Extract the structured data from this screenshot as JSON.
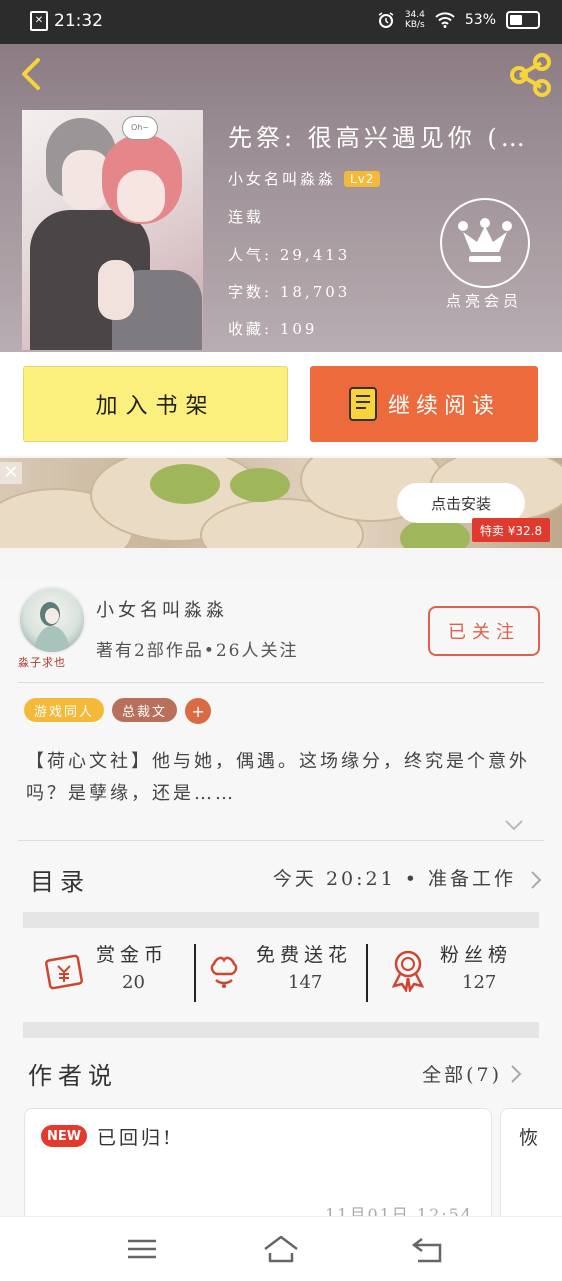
{
  "status_bar": {
    "time": "21:32",
    "net_speed_top": "34.4",
    "net_speed_unit": "KB/s",
    "battery": "53%",
    "battery_level": 0.53
  },
  "book": {
    "title": "先祭: 很高兴遇见你 (…",
    "author": "小女名叫淼淼",
    "author_level": "Lv2",
    "status": "连载",
    "popularity_label": "人气:",
    "popularity": "29,413",
    "words_label": "字数:",
    "words": "18,703",
    "favorites_label": "收藏:",
    "favorites": "109",
    "vip_label": "点亮会员",
    "cover_bubble": "Oh~"
  },
  "actions": {
    "add_shelf": "加入书架",
    "continue_read": "继续阅读"
  },
  "ad": {
    "install": "点击安装",
    "price": "特卖 ¥32.8"
  },
  "author_card": {
    "name": "小女名叫淼淼",
    "summary": "著有2部作品•26人关注",
    "avatar_signature": "淼子求也",
    "follow_state": "已关注"
  },
  "tags": [
    {
      "label": "游戏同人",
      "color": "#f5b93a"
    },
    {
      "label": "总裁文",
      "color": "#b8705a"
    }
  ],
  "tags_more": "+",
  "description": "【荷心文社】他与她，偶遇。这场缘分，终究是个意外吗？是孽缘，还是……",
  "toc": {
    "title": "目录",
    "latest": "今天 20:21 • 准备工作"
  },
  "stats": [
    {
      "label": "赏金币",
      "value": "20"
    },
    {
      "label": "免费送花",
      "value": "147"
    },
    {
      "label": "粉丝榜",
      "value": "127"
    }
  ],
  "author_says": {
    "title": "作者说",
    "all": "全部(7)",
    "posts": [
      {
        "badge": "NEW",
        "text": "已回归!",
        "date": "11月01日 12:54"
      },
      {
        "text": "恢"
      }
    ]
  },
  "colors": {
    "accent": "#ec6a3c",
    "shelf": "#fbef7d",
    "follow": "#e0604b"
  }
}
